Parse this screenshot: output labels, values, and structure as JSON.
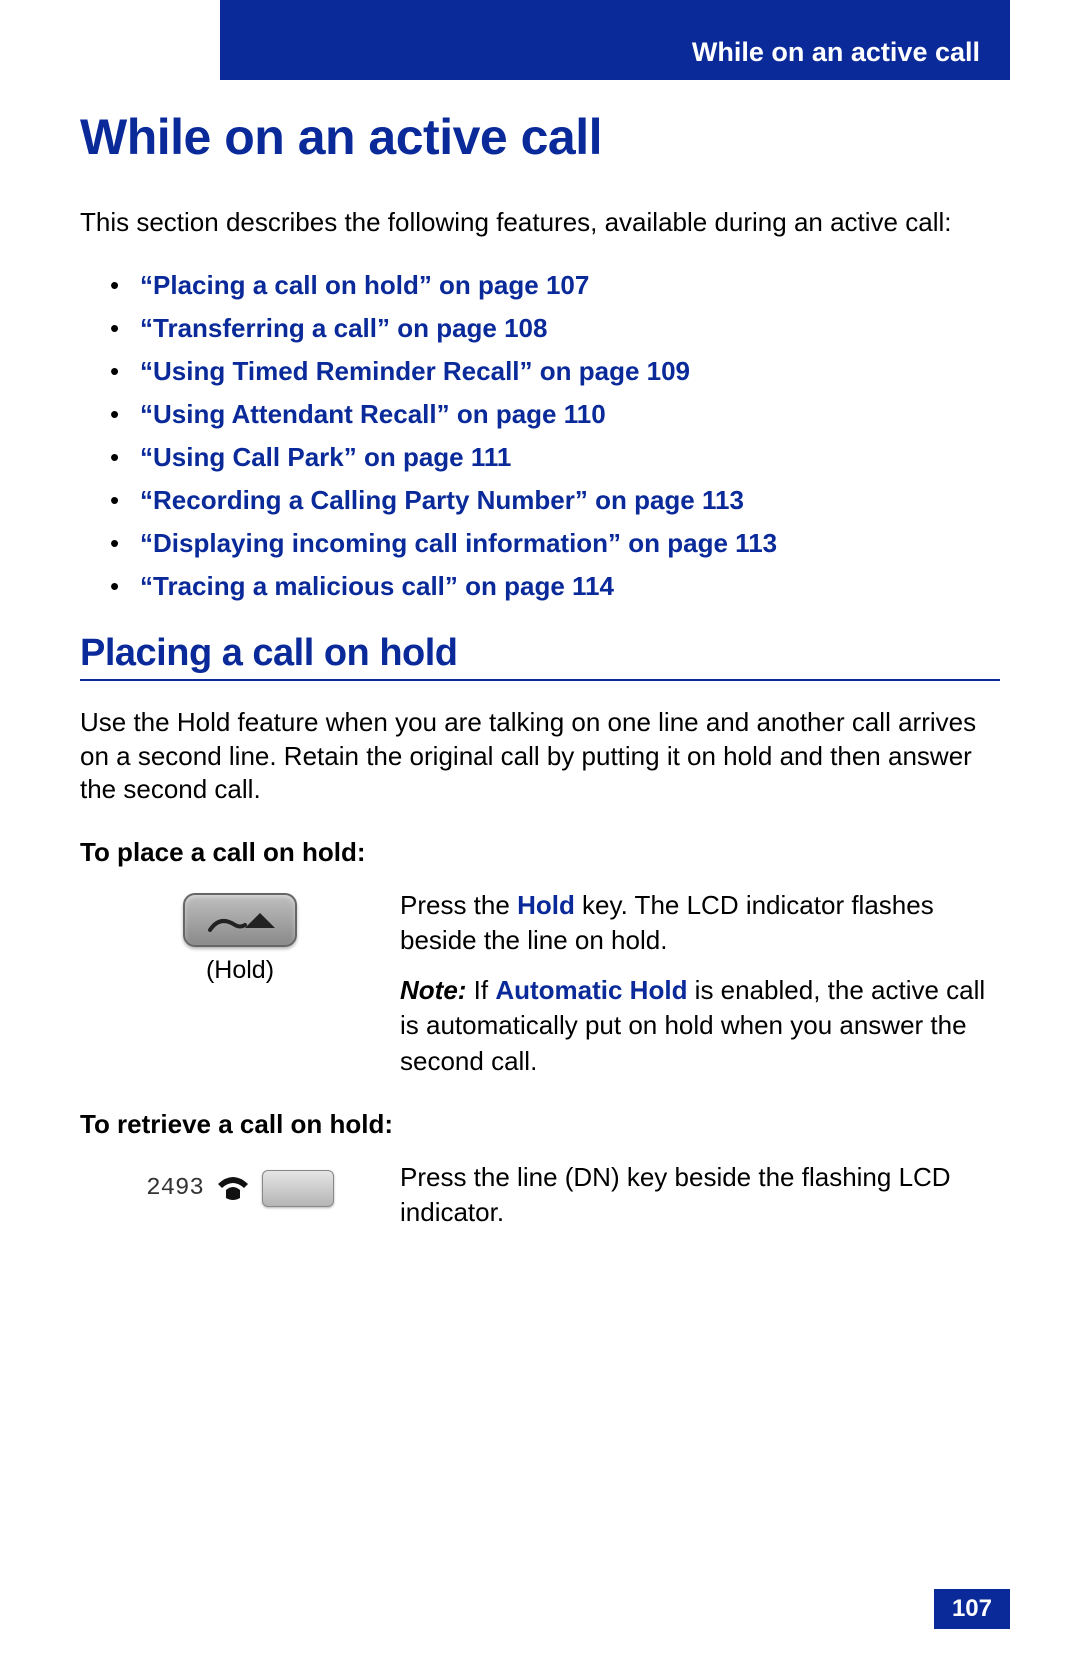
{
  "header": {
    "tab_title": "While on an active call"
  },
  "title": "While on an active call",
  "intro": "This section describes the following features, available during an active call:",
  "links": [
    "“Placing a call on hold” on page 107",
    "“Transferring a call” on page 108",
    "“Using Timed Reminder Recall” on page 109",
    "“Using Attendant Recall” on page 110",
    "“Using Call Park” on page 111",
    "“Recording a Calling Party Number” on page 113",
    "“Displaying incoming call information” on page 113",
    "“Tracing a malicious call” on page 114"
  ],
  "section": {
    "heading": "Placing a call on hold",
    "para": "Use the Hold feature when you are talking on one line and another call arrives on a second line. Retain the original call by putting it on hold and then answer the second call.",
    "place": {
      "heading": "To place a call on hold:",
      "caption": "(Hold)",
      "text_pre": "Press the ",
      "text_key": "Hold",
      "text_post": " key. The LCD indicator flashes beside the line on hold.",
      "note_label": "Note:",
      "note_pre": " If ",
      "note_key": "Automatic Hold",
      "note_post": " is enabled, the active call is automatically put on hold when you answer the second call."
    },
    "retrieve": {
      "heading": "To retrieve a call on hold:",
      "dn_number": "2493",
      "text": "Press the line (DN) key beside the flashing LCD indicator."
    }
  },
  "page_number": "107"
}
